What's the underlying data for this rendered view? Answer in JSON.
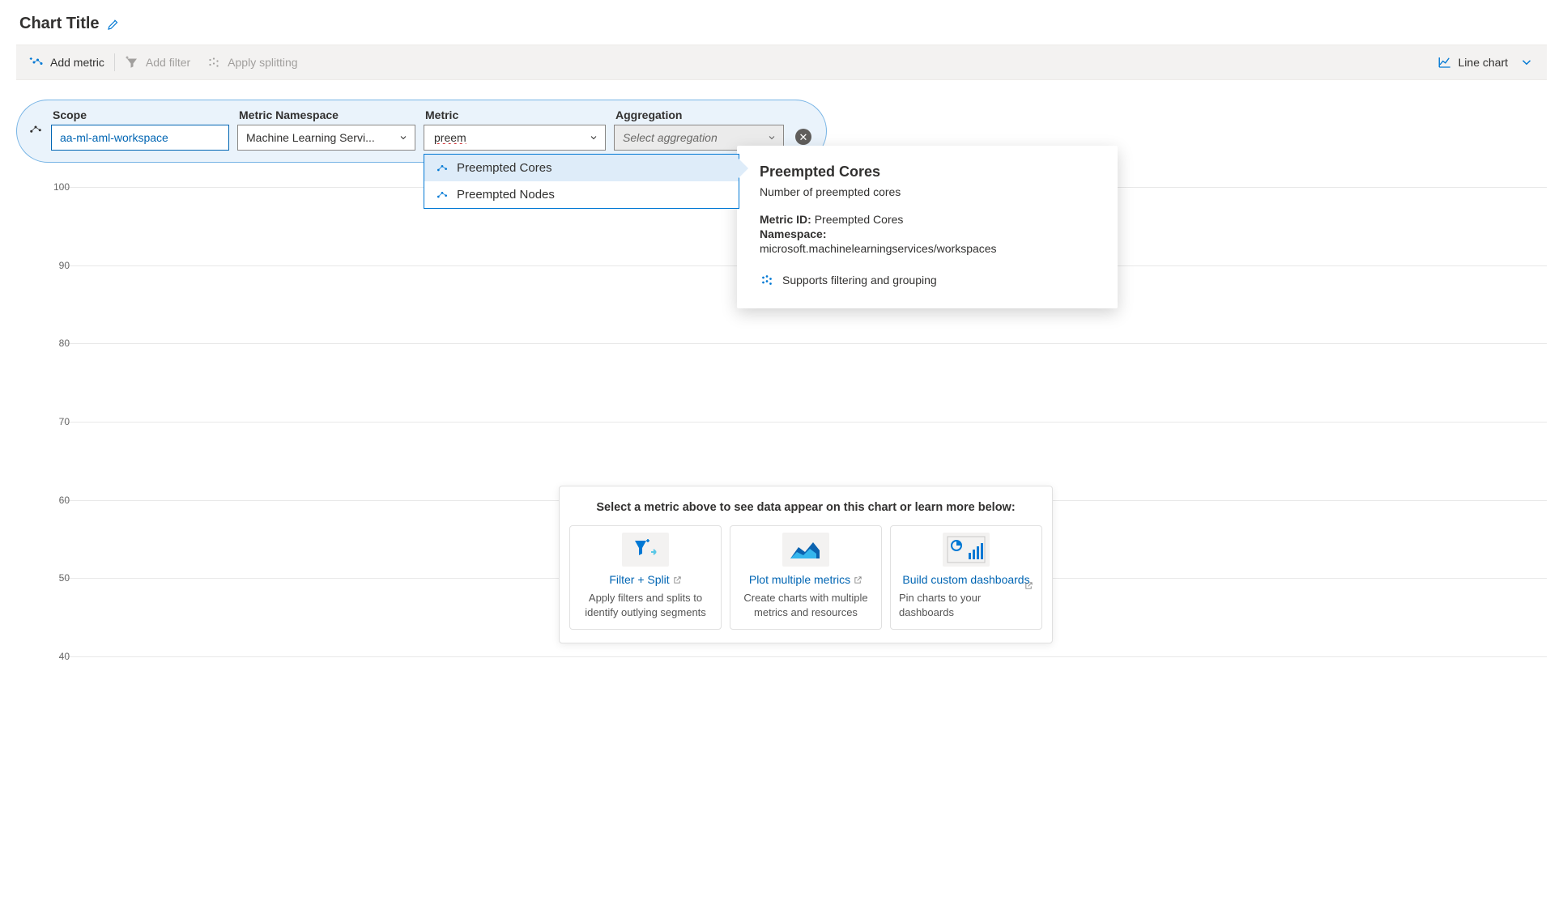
{
  "title": "Chart Title",
  "toolbar": {
    "add_metric": "Add metric",
    "add_filter": "Add filter",
    "apply_splitting": "Apply splitting",
    "chart_type_label": "Line chart"
  },
  "config": {
    "scope": {
      "label": "Scope",
      "value": "aa-ml-aml-workspace"
    },
    "namespace": {
      "label": "Metric Namespace",
      "value": "Machine Learning Servi..."
    },
    "metric": {
      "label": "Metric",
      "input_value": "preem"
    },
    "aggregation": {
      "label": "Aggregation",
      "placeholder": "Select aggregation"
    }
  },
  "metric_dropdown": {
    "items": [
      {
        "label": "Preempted Cores",
        "selected": true
      },
      {
        "label": "Preempted Nodes",
        "selected": false
      }
    ]
  },
  "tooltip": {
    "title": "Preempted Cores",
    "subtitle": "Number of preempted cores",
    "metric_id_label": "Metric ID:",
    "metric_id_value": "Preempted Cores",
    "namespace_label": "Namespace:",
    "namespace_value": "microsoft.machinelearningservices/workspaces",
    "supports_text": "Supports filtering and grouping"
  },
  "chart_data": {
    "type": "line",
    "title": "",
    "xlabel": "",
    "ylabel": "",
    "ylim": [
      40,
      100
    ],
    "yticks": [
      40,
      50,
      60,
      70,
      80,
      90,
      100
    ],
    "series": []
  },
  "learn": {
    "header": "Select a metric above to see data appear on this chart or learn more below:",
    "cards": [
      {
        "title": "Filter + Split",
        "desc": "Apply filters and splits to identify outlying segments"
      },
      {
        "title": "Plot multiple metrics",
        "desc": "Create charts with multiple metrics and resources"
      },
      {
        "title": "Build custom dashboards",
        "desc": "Pin charts to your dashboards"
      }
    ]
  }
}
